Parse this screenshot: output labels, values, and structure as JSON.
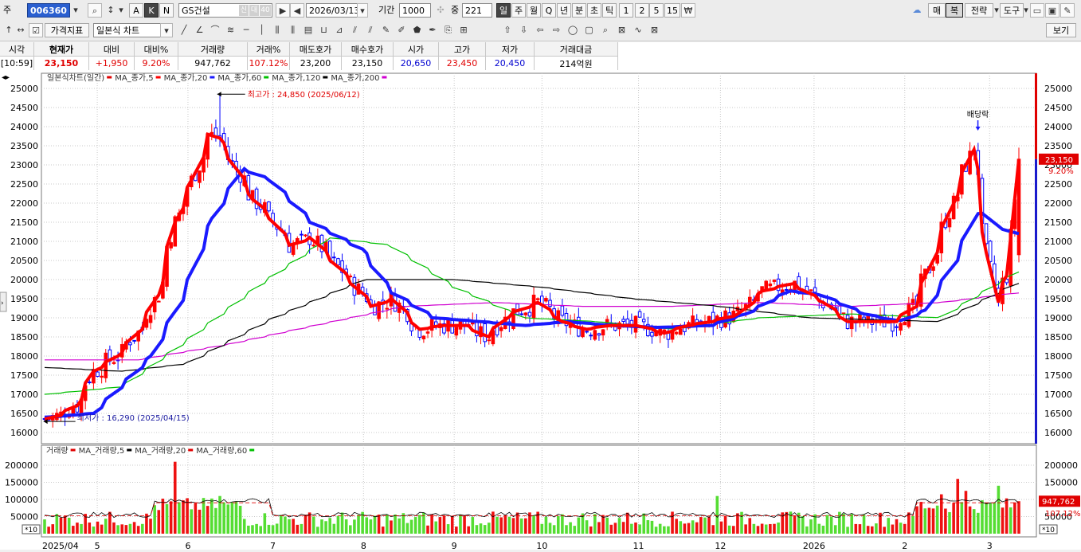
{
  "toolbar": {
    "market_label": "주",
    "code": "006360",
    "name": "GS건설",
    "tag_credit": "신",
    "tag_loan": "대",
    "tag_ratio": "40",
    "date": "2026/03/13",
    "period_label": "기간",
    "period_value": "1000",
    "middle_label": "중",
    "count_value": "221",
    "btn_a": "A",
    "btn_k": "K",
    "btn_n": "N",
    "timeframes": [
      "일",
      "주",
      "월",
      "Q",
      "년",
      "분",
      "초",
      "틱",
      "1",
      "2",
      "5",
      "15"
    ],
    "right_buttons": [
      "매",
      "복",
      "전략",
      "도구"
    ],
    "indicator_button": "가격지표",
    "chart_type": "일본식 차트",
    "view_button": "보기"
  },
  "quote": {
    "headers": [
      "시각",
      "현재가",
      "대비",
      "대비%",
      "거래량",
      "거래%",
      "매도호가",
      "매수호가",
      "시가",
      "고가",
      "저가",
      "거래대금"
    ],
    "values": [
      "[10:59]",
      "23,150",
      "+1,950",
      "9.20%",
      "947,762",
      "107.12%",
      "23,200",
      "23,150",
      "20,650",
      "23,450",
      "20,450",
      "214억원"
    ]
  },
  "price_panel": {
    "legend": [
      {
        "label": "일본식차트(일간)",
        "color": "#e00000"
      },
      {
        "label": "MA_종가,5",
        "color": "#ff0000"
      },
      {
        "label": "MA_종가,20",
        "color": "#1a1aff"
      },
      {
        "label": "MA_종가,60",
        "color": "#00c000"
      },
      {
        "label": "MA_종가,120",
        "color": "#000000"
      },
      {
        "label": "MA_종가,200",
        "color": "#d000d0"
      }
    ],
    "high_annotation": "최고가 : 24,850 (2025/06/12)",
    "low_annotation": "최저가 : 16,290 (2025/04/15)",
    "dividend_label": "배당락",
    "current_price_tag": "23,150",
    "current_pct_tag": "9.20%"
  },
  "volume_panel": {
    "legend": [
      {
        "label": "거래량",
        "color": "#e00000"
      },
      {
        "label": "MA_거래량,5",
        "color": "#000000"
      },
      {
        "label": "MA_거래량,20",
        "color": "#e00000"
      },
      {
        "label": "MA_거래량,60",
        "color": "#00c000"
      }
    ],
    "current_volume_tag": "947,762",
    "current_pct_tag": "107.12%",
    "scale_label": "*10"
  },
  "colors": {
    "up": "#ff0000",
    "down": "#0000ff",
    "ma5": "#ff0000",
    "ma20": "#1a1aff",
    "ma60": "#00c000",
    "ma120": "#000000",
    "ma200": "#d000d0"
  },
  "chart_data": {
    "type": "candlestick",
    "price_ylim": [
      16000,
      25000
    ],
    "price_ticks": [
      16000,
      16500,
      17000,
      17500,
      18000,
      18500,
      19000,
      19500,
      20000,
      20500,
      21000,
      21500,
      22000,
      22500,
      23000,
      23500,
      24000,
      24500,
      25000
    ],
    "volume_ylim": [
      0,
      200000
    ],
    "volume_ticks": [
      50000,
      100000,
      150000,
      200000
    ],
    "x_ticks": [
      "2025/04",
      "5",
      "6",
      "7",
      "8",
      "9",
      "10",
      "11",
      "12",
      "2026",
      "2",
      "3"
    ],
    "close_path": [
      [
        "2025-04-14",
        16350
      ],
      [
        "2025-04-18",
        16450
      ],
      [
        "2025-04-24",
        16700
      ],
      [
        "2025-04-30",
        17600
      ],
      [
        "2025-05-08",
        18000
      ],
      [
        "2025-05-16",
        18700
      ],
      [
        "2025-05-22",
        19600
      ],
      [
        "2025-05-28",
        21500
      ],
      [
        "2025-06-03",
        22600
      ],
      [
        "2025-06-09",
        23800
      ],
      [
        "2025-06-12",
        23700
      ],
      [
        "2025-06-18",
        22900
      ],
      [
        "2025-06-24",
        22100
      ],
      [
        "2025-06-30",
        21600
      ],
      [
        "2025-07-07",
        20900
      ],
      [
        "2025-07-14",
        21100
      ],
      [
        "2025-07-21",
        20500
      ],
      [
        "2025-07-28",
        19900
      ],
      [
        "2025-08-04",
        19300
      ],
      [
        "2025-08-11",
        19500
      ],
      [
        "2025-08-20",
        18700
      ],
      [
        "2025-08-28",
        18800
      ],
      [
        "2025-09-05",
        18800
      ],
      [
        "2025-09-12",
        18500
      ],
      [
        "2025-09-20",
        19100
      ],
      [
        "2025-09-30",
        19400
      ],
      [
        "2025-10-08",
        18900
      ],
      [
        "2025-10-16",
        18700
      ],
      [
        "2025-10-24",
        18800
      ],
      [
        "2025-11-03",
        18800
      ],
      [
        "2025-11-12",
        18600
      ],
      [
        "2025-11-20",
        18800
      ],
      [
        "2025-11-28",
        18900
      ],
      [
        "2025-12-08",
        19100
      ],
      [
        "2025-12-16",
        19700
      ],
      [
        "2025-12-26",
        19900
      ],
      [
        "2026-01-06",
        19400
      ],
      [
        "2026-01-14",
        18900
      ],
      [
        "2026-01-22",
        18900
      ],
      [
        "2026-01-30",
        18900
      ],
      [
        "2026-02-06",
        19300
      ],
      [
        "2026-02-12",
        20500
      ],
      [
        "2026-02-20",
        22200
      ],
      [
        "2026-02-26",
        23400
      ],
      [
        "2026-03-03",
        20700
      ],
      [
        "2026-03-06",
        19400
      ],
      [
        "2026-03-10",
        20100
      ],
      [
        "2026-03-13",
        23150
      ]
    ],
    "ma20_path": [
      [
        "2025-04-14",
        16400
      ],
      [
        "2025-04-30",
        16500
      ],
      [
        "2025-05-08",
        17100
      ],
      [
        "2025-05-20",
        18000
      ],
      [
        "2025-05-31",
        19600
      ],
      [
        "2025-06-10",
        21600
      ],
      [
        "2025-06-20",
        22900
      ],
      [
        "2025-06-30",
        22600
      ],
      [
        "2025-07-14",
        21500
      ],
      [
        "2025-07-31",
        20800
      ],
      [
        "2025-08-10",
        19700
      ],
      [
        "2025-08-25",
        19000
      ],
      [
        "2025-09-10",
        18900
      ],
      [
        "2025-09-25",
        18800
      ],
      [
        "2025-10-10",
        18900
      ],
      [
        "2025-10-25",
        18800
      ],
      [
        "2025-11-10",
        18750
      ],
      [
        "2025-11-28",
        18800
      ],
      [
        "2025-12-10",
        19100
      ],
      [
        "2025-12-25",
        19700
      ],
      [
        "2026-01-05",
        19600
      ],
      [
        "2026-01-20",
        19100
      ],
      [
        "2026-02-01",
        18900
      ],
      [
        "2026-02-10",
        19200
      ],
      [
        "2026-02-20",
        20500
      ],
      [
        "2026-02-28",
        21900
      ],
      [
        "2026-03-06",
        21400
      ],
      [
        "2026-03-13",
        21200
      ]
    ],
    "ma60_path": [
      [
        "2025-04-14",
        17000
      ],
      [
        "2025-05-10",
        17200
      ],
      [
        "2025-06-01",
        18400
      ],
      [
        "2025-06-25",
        19800
      ],
      [
        "2025-07-20",
        21100
      ],
      [
        "2025-08-10",
        20900
      ],
      [
        "2025-09-01",
        19800
      ],
      [
        "2025-09-25",
        19000
      ],
      [
        "2025-10-20",
        18900
      ],
      [
        "2025-11-15",
        18700
      ],
      [
        "2025-12-15",
        19000
      ],
      [
        "2026-01-15",
        19100
      ],
      [
        "2026-02-15",
        19000
      ],
      [
        "2026-03-13",
        20200
      ]
    ],
    "ma120_path": [
      [
        "2025-04-14",
        17700
      ],
      [
        "2025-05-10",
        17600
      ],
      [
        "2025-06-01",
        17800
      ],
      [
        "2025-07-01",
        19000
      ],
      [
        "2025-08-01",
        20000
      ],
      [
        "2025-09-01",
        20000
      ],
      [
        "2025-10-01",
        19800
      ],
      [
        "2025-11-01",
        19500
      ],
      [
        "2025-12-01",
        19300
      ],
      [
        "2026-01-01",
        19000
      ],
      [
        "2026-02-15",
        18900
      ],
      [
        "2026-03-13",
        19900
      ]
    ],
    "ma200_path": [
      [
        "2025-04-14",
        17900
      ],
      [
        "2025-05-15",
        17900
      ],
      [
        "2025-06-15",
        18300
      ],
      [
        "2025-07-15",
        18800
      ],
      [
        "2025-08-15",
        19300
      ],
      [
        "2025-09-15",
        19400
      ],
      [
        "2025-10-15",
        19300
      ],
      [
        "2025-11-15",
        19300
      ],
      [
        "2025-12-15",
        19400
      ],
      [
        "2026-01-15",
        19300
      ],
      [
        "2026-02-15",
        19400
      ],
      [
        "2026-03-13",
        19650
      ]
    ],
    "high": {
      "date": "2025-06-12",
      "value": 24850
    },
    "low": {
      "date": "2025-04-15",
      "value": 16290
    },
    "last": {
      "date": "2026-03-13",
      "open": 20650,
      "high": 23450,
      "low": 20450,
      "close": 23150,
      "volume": 947762
    },
    "volume_peaks": [
      [
        "2025-05-28",
        210000
      ],
      [
        "2025-06-12",
        110000
      ],
      [
        "2025-12-01",
        110000
      ],
      [
        "2026-02-16",
        115000
      ],
      [
        "2026-02-20",
        160000
      ],
      [
        "2026-02-24",
        125000
      ],
      [
        "2026-03-06",
        140000
      ],
      [
        "2026-03-13",
        94776
      ]
    ]
  }
}
